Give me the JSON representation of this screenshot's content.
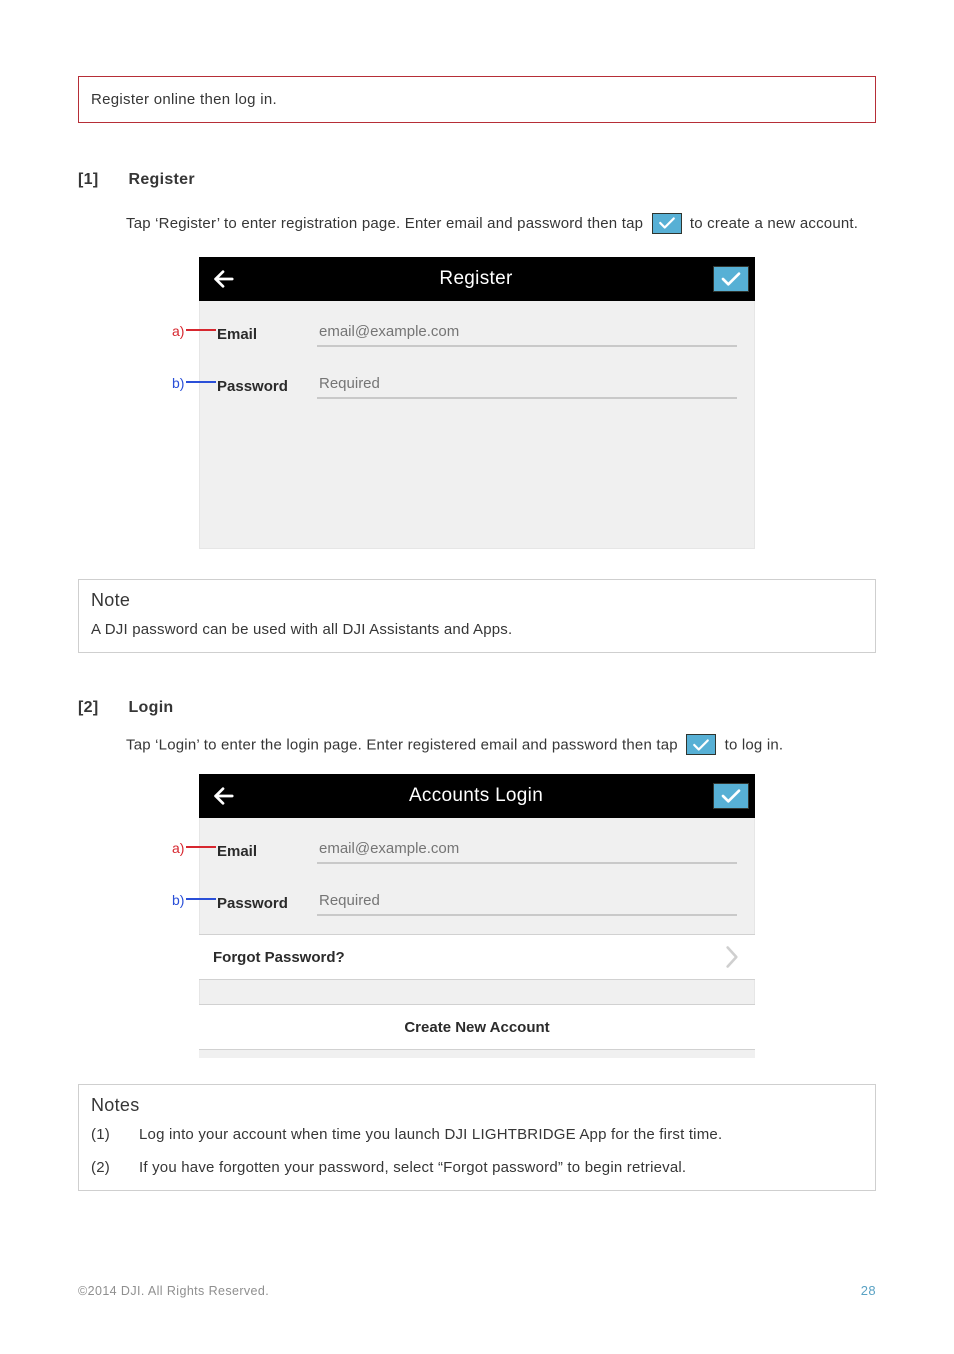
{
  "intro": "Register online then log in.",
  "section1": {
    "num": "[1]",
    "title": "Register",
    "body_before": "Tap ‘Register’ to enter registration page. Enter email and password then tap",
    "body_after": "to create a new account."
  },
  "shot_register": {
    "title": "Register",
    "email_label": "Email",
    "email_placeholder": "email@example.com",
    "password_label": "Password",
    "password_placeholder": "Required",
    "anno_a": "a)",
    "anno_b": "b)"
  },
  "note_box": {
    "title": "Note",
    "body": "A DJI password can be used with all DJI Assistants and Apps."
  },
  "section2": {
    "num": "[2]",
    "title": "Login",
    "body_before": "Tap ‘Login’ to enter the login page. Enter registered email and password then tap",
    "body_after": "to log in."
  },
  "shot_login": {
    "title": "Accounts Login",
    "email_label": "Email",
    "email_placeholder": "email@example.com",
    "password_label": "Password",
    "password_placeholder": "Required",
    "forgot": "Forgot Password?",
    "create": "Create New Account",
    "anno_a": "a)",
    "anno_b": "b)"
  },
  "notes_box": {
    "title": "Notes",
    "items": [
      {
        "num": "(1)",
        "text": "Log into your account when time you launch DJI LIGHTBRIDGE App for the first time."
      },
      {
        "num": "(2)",
        "text": "If you have forgotten your password, select “Forgot password” to begin retrieval."
      }
    ]
  },
  "footer": {
    "copyright": "©2014 DJI. All Rights Reserved.",
    "page": "28"
  }
}
